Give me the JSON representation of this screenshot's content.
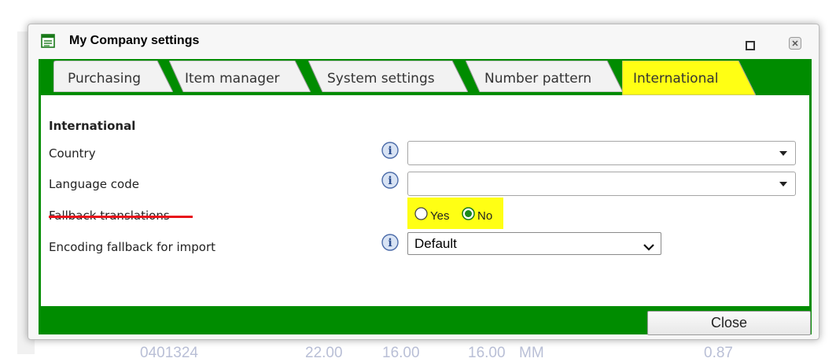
{
  "window": {
    "title": "My Company settings"
  },
  "tabs": [
    {
      "label": "Purchasing",
      "active": false
    },
    {
      "label": "Item manager",
      "active": false
    },
    {
      "label": "System settings",
      "active": false
    },
    {
      "label": "Number pattern",
      "active": false
    },
    {
      "label": "International",
      "active": true
    }
  ],
  "section": {
    "heading": "International"
  },
  "fields": {
    "country": {
      "label": "Country",
      "value": ""
    },
    "language_code": {
      "label": "Language code",
      "value": ""
    },
    "fallback_translations": {
      "label": "Fallback translations",
      "options": [
        "Yes",
        "No"
      ],
      "selected": "No"
    },
    "encoding_fallback": {
      "label": "Encoding fallback for import",
      "value": "Default"
    }
  },
  "footer": {
    "close_label": "Close"
  },
  "background": {
    "row_values": [
      "0401324",
      "22.00",
      "16.00",
      "16.00",
      "MM",
      "0.87"
    ]
  },
  "colors": {
    "frame_green": "#008c00",
    "highlight_yellow": "#ffff14",
    "underline_red": "#e8101a"
  },
  "icons": {
    "window": "settings-window-icon",
    "info": "info-icon",
    "maximize": "maximize-icon",
    "close": "close-icon"
  }
}
